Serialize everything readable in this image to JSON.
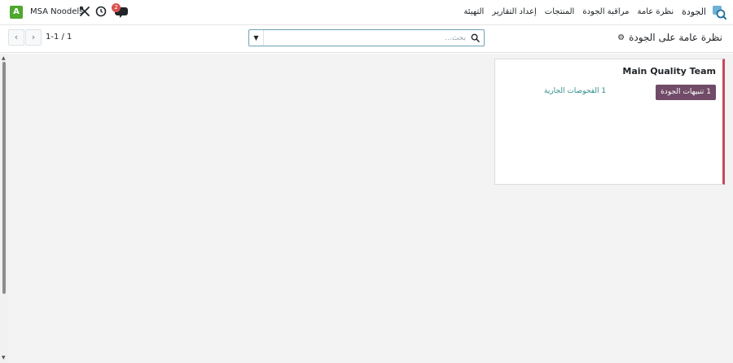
{
  "navbar": {
    "avatar_letter": "A",
    "company": "MSA Noodels",
    "chat_badge": "2",
    "app_name": "الجودة",
    "menu_items": [
      "نظرة عامة",
      "مراقبة الجودة",
      "المنتجات",
      "إعداد التقارير",
      "التهيئة"
    ]
  },
  "control": {
    "breadcrumb": "نظرة عامة على الجودة",
    "search_placeholder": "بحث...",
    "pager_value": "1-1 / 1"
  },
  "card": {
    "title": "Main Quality Team",
    "alerts_button": "1 تنبيهات الجودة",
    "checks_link": "1 الفحوصات الجارية"
  },
  "colors": {
    "accent": "#714b67",
    "link": "#2d8e8a",
    "card_border": "#c8485d",
    "avatar": "#4ea72e"
  }
}
